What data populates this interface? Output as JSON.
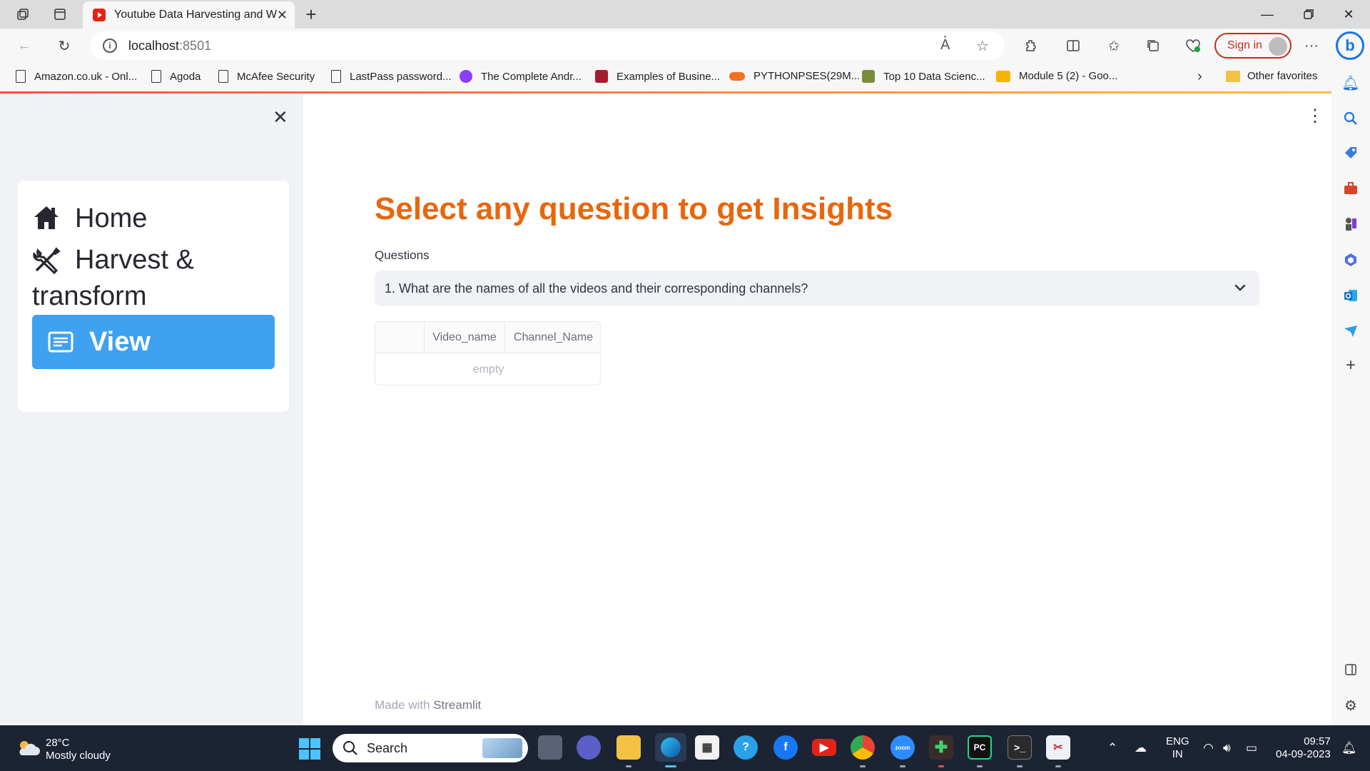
{
  "browser": {
    "tab_title": "Youtube Data Harvesting and Wa",
    "address_host": "localhost",
    "address_port": ":8501",
    "signin_label": "Sign in",
    "favorites": [
      {
        "label": "Amazon.co.uk - Onl..."
      },
      {
        "label": "Agoda"
      },
      {
        "label": "McAfee Security"
      },
      {
        "label": "LastPass password..."
      },
      {
        "label": "The Complete Andr..."
      },
      {
        "label": "Examples of Busine..."
      },
      {
        "label": "PYTHONPSES(29M..."
      },
      {
        "label": "Top 10 Data Scienc..."
      },
      {
        "label": "Module 5 (2) - Goo..."
      }
    ],
    "other_favorites": "Other favorites"
  },
  "sidebar": {
    "menu": [
      {
        "label": "Home",
        "icon": "home-icon"
      },
      {
        "label_line1": "Harvest &",
        "label_line2": "transform",
        "icon": "tools-icon"
      },
      {
        "label": "View",
        "icon": "document-icon",
        "active": true
      }
    ],
    "active_color": "#3ea1f2"
  },
  "main": {
    "title": "Select any question to get Insights",
    "title_color": "#e8660d",
    "questions_label": "Questions",
    "selected_question": "1. What are the names of all the videos and their corresponding channels?",
    "table": {
      "columns": [
        "",
        "Video_name",
        "Channel_Name"
      ],
      "empty_text": "empty"
    },
    "footer_prefix": "Made with ",
    "footer_brand": "Streamlit"
  },
  "taskbar": {
    "weather_temp": "28°C",
    "weather_desc": "Mostly cloudy",
    "search_placeholder": "Search",
    "lang_line1": "ENG",
    "lang_line2": "IN",
    "time": "09:57",
    "date": "04-09-2023"
  }
}
